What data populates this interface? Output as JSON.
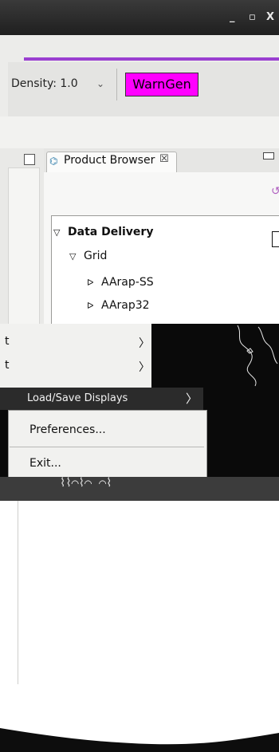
{
  "window": {
    "controls": {
      "minimize": "_",
      "maximize": "▫",
      "close": "X"
    }
  },
  "toolbar": {
    "density_label": "Density: 1.0",
    "density_arrow": "⌄",
    "warngen_label": "WarnGen",
    "warngen_color": "#ff00ff",
    "accent_line_color": "#9a3fd0"
  },
  "product_browser": {
    "tab_icon": "product-browser-icon",
    "tab_label": "Product Browser",
    "tab_close": "☒",
    "tree": [
      {
        "label": "Data Delivery",
        "arrow": "▽",
        "level": 0,
        "bold": true
      },
      {
        "label": "Grid",
        "arrow": "▽",
        "level": 1,
        "bold": false
      },
      {
        "label": "AArap-SS",
        "arrow": "ᐅ",
        "level": 2,
        "bold": false
      },
      {
        "label": "AArap32",
        "arrow": "ᐅ",
        "level": 2,
        "bold": false
      }
    ]
  },
  "menu": {
    "submenu_items": [
      {
        "label": "t",
        "arrow": "〉"
      },
      {
        "label": "t",
        "arrow": "〉"
      }
    ],
    "load_save_label": "Load/Save Displays",
    "load_save_arrow": "〉",
    "preferences_label": "Preferences...",
    "exit_label": "Exit..."
  }
}
